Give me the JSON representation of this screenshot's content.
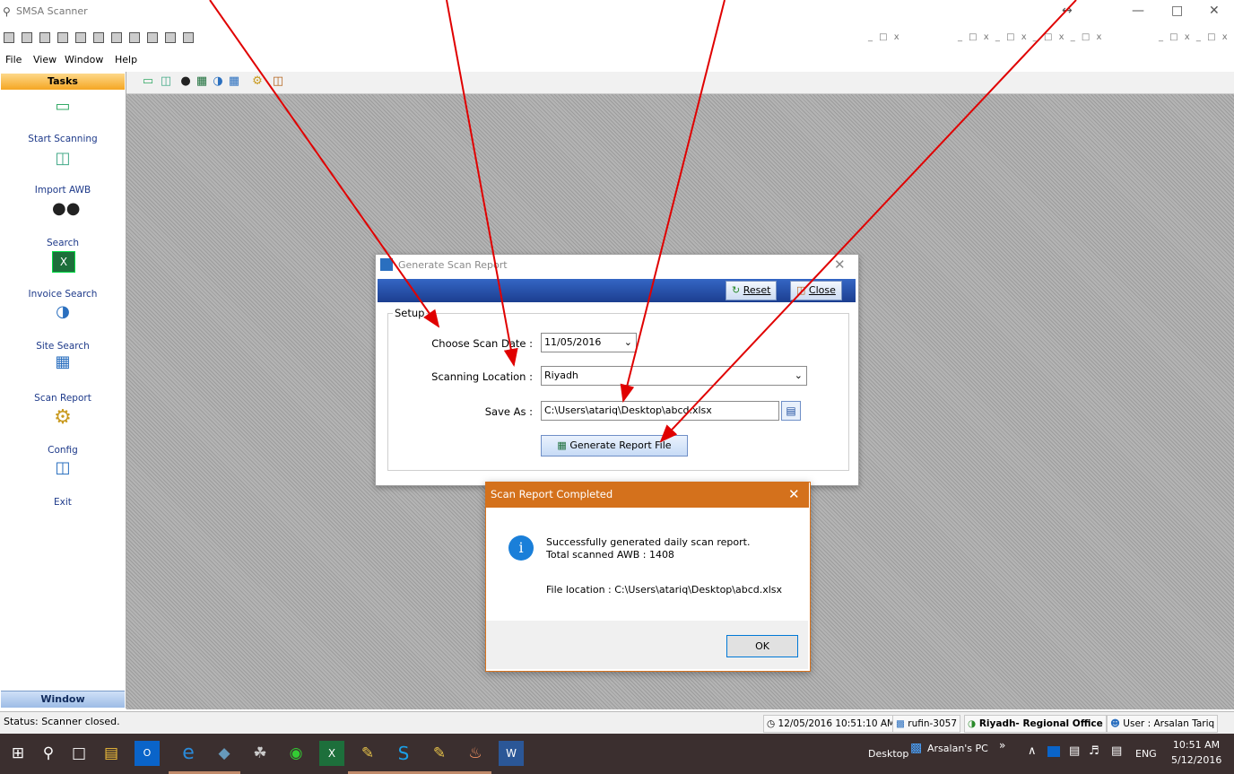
{
  "app": {
    "title": "SMSA Scanner"
  },
  "menu": [
    "File",
    "View",
    "Window",
    "Help"
  ],
  "sidebar": {
    "header": "Tasks",
    "footer": "Window",
    "items": [
      {
        "label": "Start Scanning",
        "icon": "scanner-icon"
      },
      {
        "label": "Import AWB",
        "icon": "import-icon"
      },
      {
        "label": "Search",
        "icon": "binoculars-icon"
      },
      {
        "label": "Invoice Search",
        "icon": "excel-icon"
      },
      {
        "label": "Site Search",
        "icon": "globe-icon"
      },
      {
        "label": "Scan Report",
        "icon": "report-icon"
      },
      {
        "label": "Config",
        "icon": "wrench-icon"
      },
      {
        "label": "Exit",
        "icon": "door-icon"
      }
    ]
  },
  "generate_dialog": {
    "title": "Generate Scan Report",
    "reset_label": "Reset",
    "close_label": "Close",
    "group_label": "Setup",
    "scan_date_label": "Choose Scan Date :",
    "scan_date_value": "11/05/2016",
    "location_label": "Scanning Location :",
    "location_value": "Riyadh",
    "save_as_label": "Save As :",
    "save_as_value": "C:\\Users\\atariq\\Desktop\\abcd.xlsx",
    "generate_label": "Generate Report File"
  },
  "message_box": {
    "title": "Scan Report Completed",
    "line1": "Successfully generated daily scan report.",
    "line2": "Total scanned AWB : 1408",
    "line3": "File location : C:\\Users\\atariq\\Desktop\\abcd.xlsx",
    "ok_label": "OK"
  },
  "status": {
    "text": "Status: Scanner closed.",
    "datetime": "12/05/2016 10:51:10 AM",
    "machine": "rufin-3057",
    "office": "Riyadh- Regional Office",
    "user": "User : Arsalan Tariq"
  },
  "taskbar": {
    "desktop_label": "Desktop",
    "pc_label": "Arsalan's PC",
    "lang": "ENG",
    "time": "10:51 AM",
    "date": "5/12/2016"
  },
  "colors": {
    "tasks_header": "#f5a623",
    "dialog_bar": "#1c3e90",
    "msg_title": "#d4711c",
    "taskbar": "#3b2f2f",
    "arrow": "#e00000"
  }
}
